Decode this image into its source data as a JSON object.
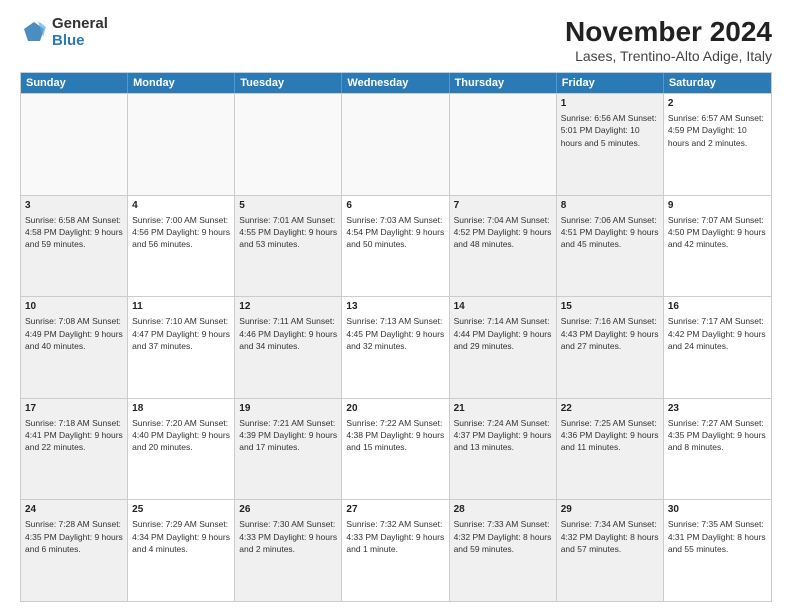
{
  "header": {
    "logo_line1": "General",
    "logo_line2": "Blue",
    "title": "November 2024",
    "subtitle": "Lases, Trentino-Alto Adige, Italy"
  },
  "days_of_week": [
    "Sunday",
    "Monday",
    "Tuesday",
    "Wednesday",
    "Thursday",
    "Friday",
    "Saturday"
  ],
  "weeks": [
    [
      {
        "day": "",
        "info": "",
        "empty": true
      },
      {
        "day": "",
        "info": "",
        "empty": true
      },
      {
        "day": "",
        "info": "",
        "empty": true
      },
      {
        "day": "",
        "info": "",
        "empty": true
      },
      {
        "day": "",
        "info": "",
        "empty": true
      },
      {
        "day": "1",
        "info": "Sunrise: 6:56 AM\nSunset: 5:01 PM\nDaylight: 10 hours and 5 minutes.",
        "shaded": true
      },
      {
        "day": "2",
        "info": "Sunrise: 6:57 AM\nSunset: 4:59 PM\nDaylight: 10 hours and 2 minutes."
      }
    ],
    [
      {
        "day": "3",
        "info": "Sunrise: 6:58 AM\nSunset: 4:58 PM\nDaylight: 9 hours and 59 minutes.",
        "shaded": true
      },
      {
        "day": "4",
        "info": "Sunrise: 7:00 AM\nSunset: 4:56 PM\nDaylight: 9 hours and 56 minutes."
      },
      {
        "day": "5",
        "info": "Sunrise: 7:01 AM\nSunset: 4:55 PM\nDaylight: 9 hours and 53 minutes.",
        "shaded": true
      },
      {
        "day": "6",
        "info": "Sunrise: 7:03 AM\nSunset: 4:54 PM\nDaylight: 9 hours and 50 minutes."
      },
      {
        "day": "7",
        "info": "Sunrise: 7:04 AM\nSunset: 4:52 PM\nDaylight: 9 hours and 48 minutes.",
        "shaded": true
      },
      {
        "day": "8",
        "info": "Sunrise: 7:06 AM\nSunset: 4:51 PM\nDaylight: 9 hours and 45 minutes.",
        "shaded": true
      },
      {
        "day": "9",
        "info": "Sunrise: 7:07 AM\nSunset: 4:50 PM\nDaylight: 9 hours and 42 minutes."
      }
    ],
    [
      {
        "day": "10",
        "info": "Sunrise: 7:08 AM\nSunset: 4:49 PM\nDaylight: 9 hours and 40 minutes.",
        "shaded": true
      },
      {
        "day": "11",
        "info": "Sunrise: 7:10 AM\nSunset: 4:47 PM\nDaylight: 9 hours and 37 minutes."
      },
      {
        "day": "12",
        "info": "Sunrise: 7:11 AM\nSunset: 4:46 PM\nDaylight: 9 hours and 34 minutes.",
        "shaded": true
      },
      {
        "day": "13",
        "info": "Sunrise: 7:13 AM\nSunset: 4:45 PM\nDaylight: 9 hours and 32 minutes."
      },
      {
        "day": "14",
        "info": "Sunrise: 7:14 AM\nSunset: 4:44 PM\nDaylight: 9 hours and 29 minutes.",
        "shaded": true
      },
      {
        "day": "15",
        "info": "Sunrise: 7:16 AM\nSunset: 4:43 PM\nDaylight: 9 hours and 27 minutes.",
        "shaded": true
      },
      {
        "day": "16",
        "info": "Sunrise: 7:17 AM\nSunset: 4:42 PM\nDaylight: 9 hours and 24 minutes."
      }
    ],
    [
      {
        "day": "17",
        "info": "Sunrise: 7:18 AM\nSunset: 4:41 PM\nDaylight: 9 hours and 22 minutes.",
        "shaded": true
      },
      {
        "day": "18",
        "info": "Sunrise: 7:20 AM\nSunset: 4:40 PM\nDaylight: 9 hours and 20 minutes."
      },
      {
        "day": "19",
        "info": "Sunrise: 7:21 AM\nSunset: 4:39 PM\nDaylight: 9 hours and 17 minutes.",
        "shaded": true
      },
      {
        "day": "20",
        "info": "Sunrise: 7:22 AM\nSunset: 4:38 PM\nDaylight: 9 hours and 15 minutes."
      },
      {
        "day": "21",
        "info": "Sunrise: 7:24 AM\nSunset: 4:37 PM\nDaylight: 9 hours and 13 minutes.",
        "shaded": true
      },
      {
        "day": "22",
        "info": "Sunrise: 7:25 AM\nSunset: 4:36 PM\nDaylight: 9 hours and 11 minutes.",
        "shaded": true
      },
      {
        "day": "23",
        "info": "Sunrise: 7:27 AM\nSunset: 4:35 PM\nDaylight: 9 hours and 8 minutes."
      }
    ],
    [
      {
        "day": "24",
        "info": "Sunrise: 7:28 AM\nSunset: 4:35 PM\nDaylight: 9 hours and 6 minutes.",
        "shaded": true
      },
      {
        "day": "25",
        "info": "Sunrise: 7:29 AM\nSunset: 4:34 PM\nDaylight: 9 hours and 4 minutes."
      },
      {
        "day": "26",
        "info": "Sunrise: 7:30 AM\nSunset: 4:33 PM\nDaylight: 9 hours and 2 minutes.",
        "shaded": true
      },
      {
        "day": "27",
        "info": "Sunrise: 7:32 AM\nSunset: 4:33 PM\nDaylight: 9 hours and 1 minute."
      },
      {
        "day": "28",
        "info": "Sunrise: 7:33 AM\nSunset: 4:32 PM\nDaylight: 8 hours and 59 minutes.",
        "shaded": true
      },
      {
        "day": "29",
        "info": "Sunrise: 7:34 AM\nSunset: 4:32 PM\nDaylight: 8 hours and 57 minutes.",
        "shaded": true
      },
      {
        "day": "30",
        "info": "Sunrise: 7:35 AM\nSunset: 4:31 PM\nDaylight: 8 hours and 55 minutes."
      }
    ]
  ]
}
